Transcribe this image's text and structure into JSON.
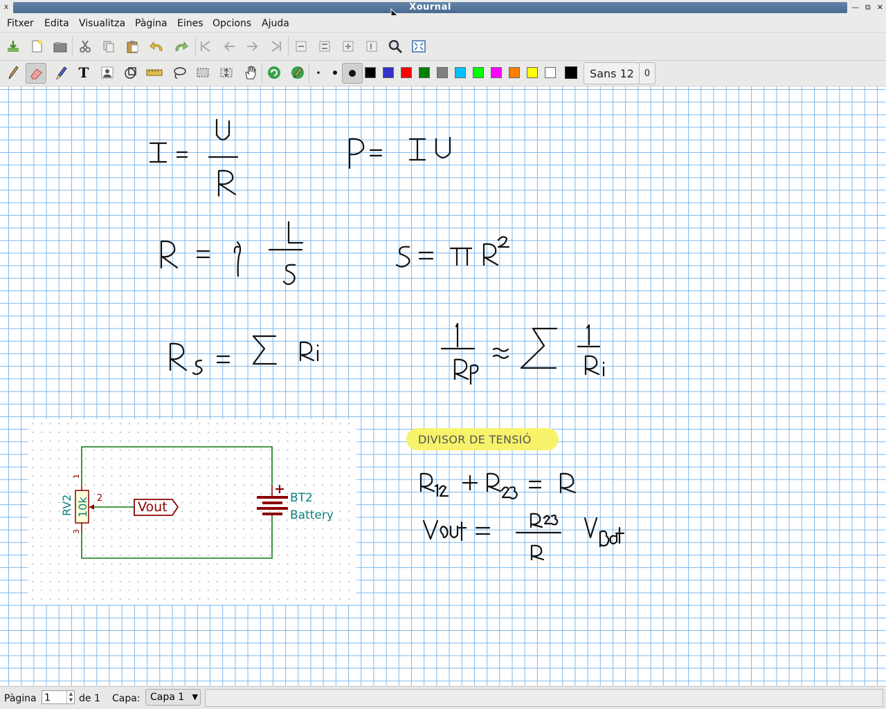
{
  "window": {
    "title": "Xournal",
    "close_glyph": "x",
    "min_glyph": "—",
    "max_glyph": "⧉",
    "win_close_glyph": "✕"
  },
  "menu": [
    "Fitxer",
    "Edita",
    "Visualitza",
    "Pàgina",
    "Eines",
    "Opcions",
    "Ajuda"
  ],
  "toolbar1": [
    {
      "icon": "save-icon"
    },
    {
      "icon": "new-page-icon"
    },
    {
      "icon": "open-icon"
    },
    {
      "icon": "cut-icon"
    },
    {
      "icon": "copy-icon"
    },
    {
      "icon": "paste-icon"
    },
    {
      "icon": "undo-icon"
    },
    {
      "icon": "redo-icon"
    },
    {
      "icon": "first-page-icon"
    },
    {
      "icon": "previous-page-icon"
    },
    {
      "icon": "next-page-icon"
    },
    {
      "icon": "last-page-icon"
    },
    {
      "icon": "zoom-out-icon"
    },
    {
      "icon": "zoom-fit-icon"
    },
    {
      "icon": "zoom-in-icon"
    },
    {
      "icon": "zoom-100-icon"
    },
    {
      "icon": "zoom-search-icon"
    },
    {
      "icon": "fullscreen-icon"
    }
  ],
  "toolbar2": {
    "tools": [
      "pen-icon",
      "eraser-icon",
      "highlighter-icon",
      "text-tool-icon",
      "image-tool-icon",
      "shape-recognizer-icon",
      "ruler-icon",
      "lasso-select-icon",
      "rect-select-icon",
      "vertical-space-icon",
      "hand-icon",
      "default-tool-icon",
      "default-pen-icon"
    ],
    "active_tool": "eraser-icon",
    "thickness": [
      "thin",
      "medium",
      "thick"
    ],
    "colors": [
      "#000000",
      "#3333cc",
      "#ff0000",
      "#008000",
      "#808080",
      "#00c0ff",
      "#00ff00",
      "#ff00ff",
      "#ff8000",
      "#ffff00",
      "#ffffff"
    ],
    "current_color": "#000000",
    "font_label": "Sans 12",
    "font_extra": "0"
  },
  "canvas": {
    "circuit": {
      "ref_rv": "RV2",
      "value_rv": "10k",
      "pin1": "1",
      "pin2": "2",
      "pin3": "3",
      "net_label": "Vout",
      "ref_bt": "BT2",
      "value_bt": "Battery",
      "plus": "+"
    },
    "highlight_label": "DIVISOR DE TENSIÓ",
    "highlight_color": "#f6f36a"
  },
  "status": {
    "page_label": "Pàgina",
    "page_value": "1",
    "page_of": "de 1",
    "layer_label": "Capa:",
    "layer_value": "Capa 1"
  }
}
